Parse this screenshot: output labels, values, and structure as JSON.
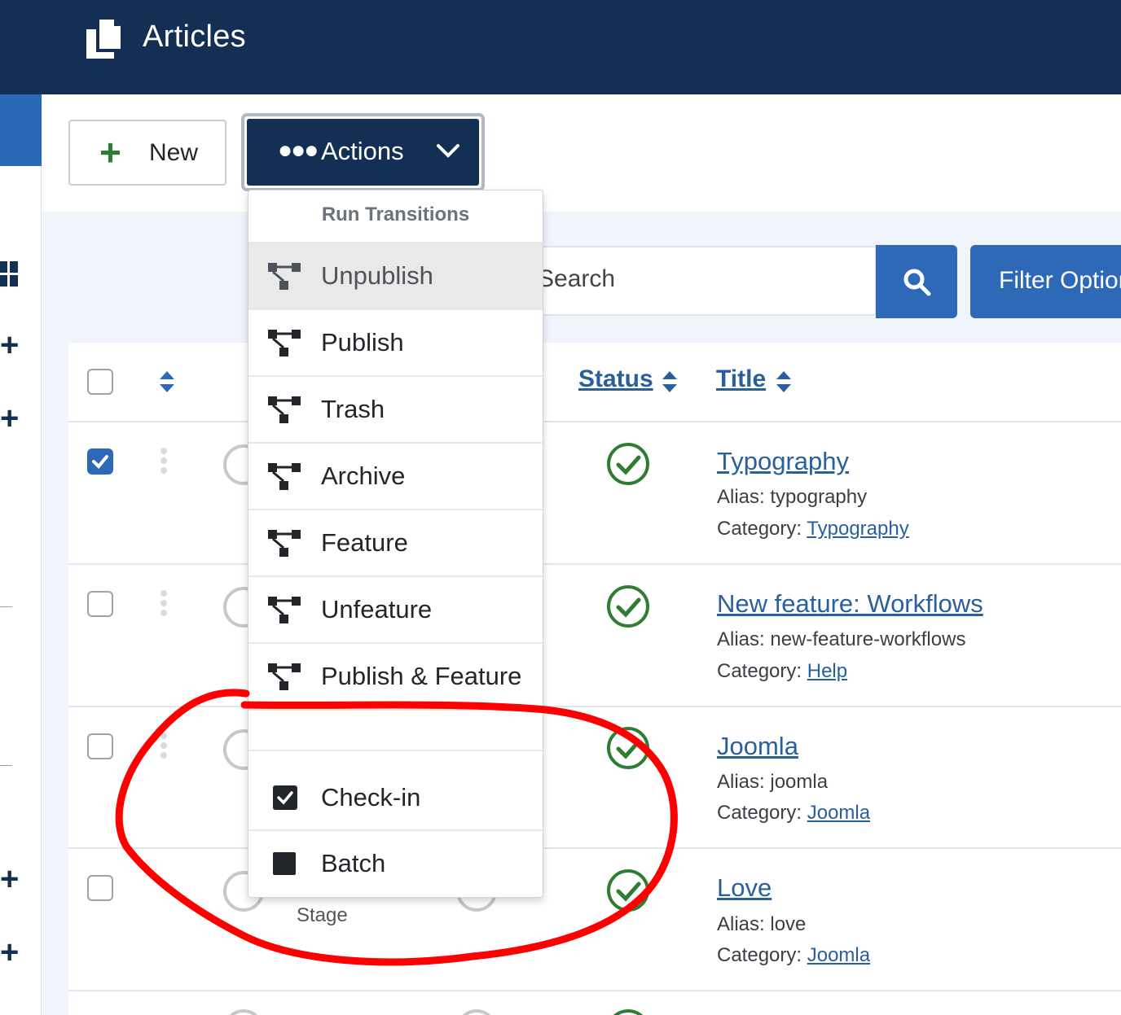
{
  "header": {
    "title": "Articles",
    "icon": "copy-icon"
  },
  "sidebar": {
    "icons": [
      "dashboard-icon",
      "plus-icon",
      "plus-icon",
      "plus-icon",
      "plus-icon"
    ]
  },
  "toolbar": {
    "new_label": "New",
    "actions_label": "Actions"
  },
  "search": {
    "placeholder": "Search",
    "filter_label": "Filter Options"
  },
  "table": {
    "headers": {
      "status": "Status",
      "title": "Title"
    },
    "rows": [
      {
        "title": "Typography",
        "alias_label": "Alias:",
        "alias": "typography",
        "category_label": "Category:",
        "category": "Typography",
        "checked": true
      },
      {
        "title": "New feature: Workflows",
        "alias_label": "Alias:",
        "alias": "new-feature-workflows",
        "category_label": "Category:",
        "category": "Help",
        "checked": false
      },
      {
        "title": "Joomla",
        "alias_label": "Alias:",
        "alias": "joomla",
        "category_label": "Category:",
        "category": "Joomla",
        "checked": false
      },
      {
        "title": "Love",
        "alias_label": "Alias:",
        "alias": "love",
        "category_label": "Category:",
        "category": "Joomla",
        "checked": false
      }
    ],
    "stage_label": "Stage"
  },
  "dropdown": {
    "header": "Run Transitions",
    "items": [
      {
        "label": "Unpublish",
        "icon": "transition-icon",
        "active": true
      },
      {
        "label": "Publish",
        "icon": "transition-icon"
      },
      {
        "label": "Trash",
        "icon": "transition-icon"
      },
      {
        "label": "Archive",
        "icon": "transition-icon"
      },
      {
        "label": "Feature",
        "icon": "transition-icon"
      },
      {
        "label": "Unfeature",
        "icon": "transition-icon"
      },
      {
        "label": "Publish & Feature",
        "icon": "transition-icon"
      },
      {
        "label": "",
        "icon": ""
      },
      {
        "label": "Check-in",
        "icon": "check-square-icon"
      },
      {
        "label": "Batch",
        "icon": "square-icon"
      }
    ]
  },
  "colors": {
    "header_bg": "#132f53",
    "accent": "#2d69b6",
    "success": "#2e7d32",
    "annotation": "#ff0000"
  }
}
